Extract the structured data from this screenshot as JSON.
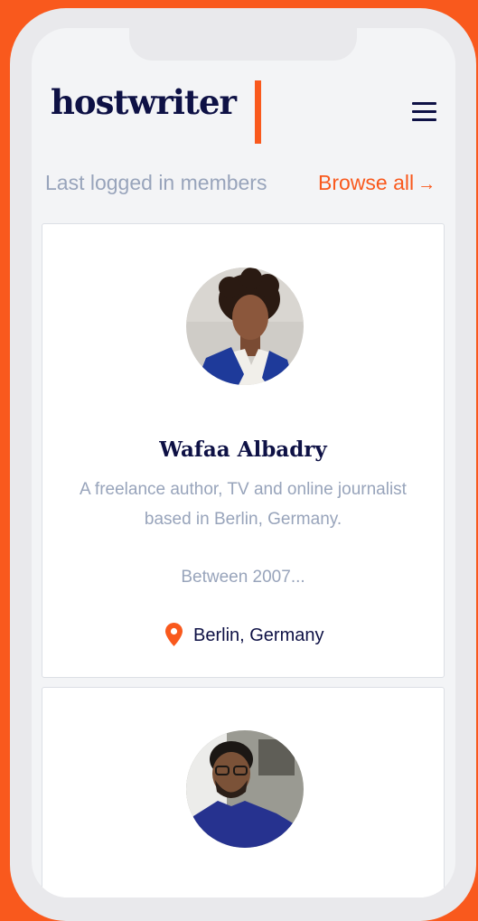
{
  "app": {
    "logo": "hostwriter",
    "menu_icon": "hamburger-menu-icon"
  },
  "section": {
    "title": "Last logged in members",
    "browse_label": "Browse all",
    "browse_arrow": "→"
  },
  "members": [
    {
      "name": "Wafaa Albadry",
      "bio_line_1": "A freelance author, TV and online journalist",
      "bio_line_2": "based in Berlin, Germany.",
      "bio_line_3": "Between 2007...",
      "location": "Berlin, Germany"
    }
  ],
  "colors": {
    "brand_orange": "#f9591d",
    "navy": "#0e1145",
    "muted_text": "#98a4bb",
    "background": "#f3f4f6"
  }
}
